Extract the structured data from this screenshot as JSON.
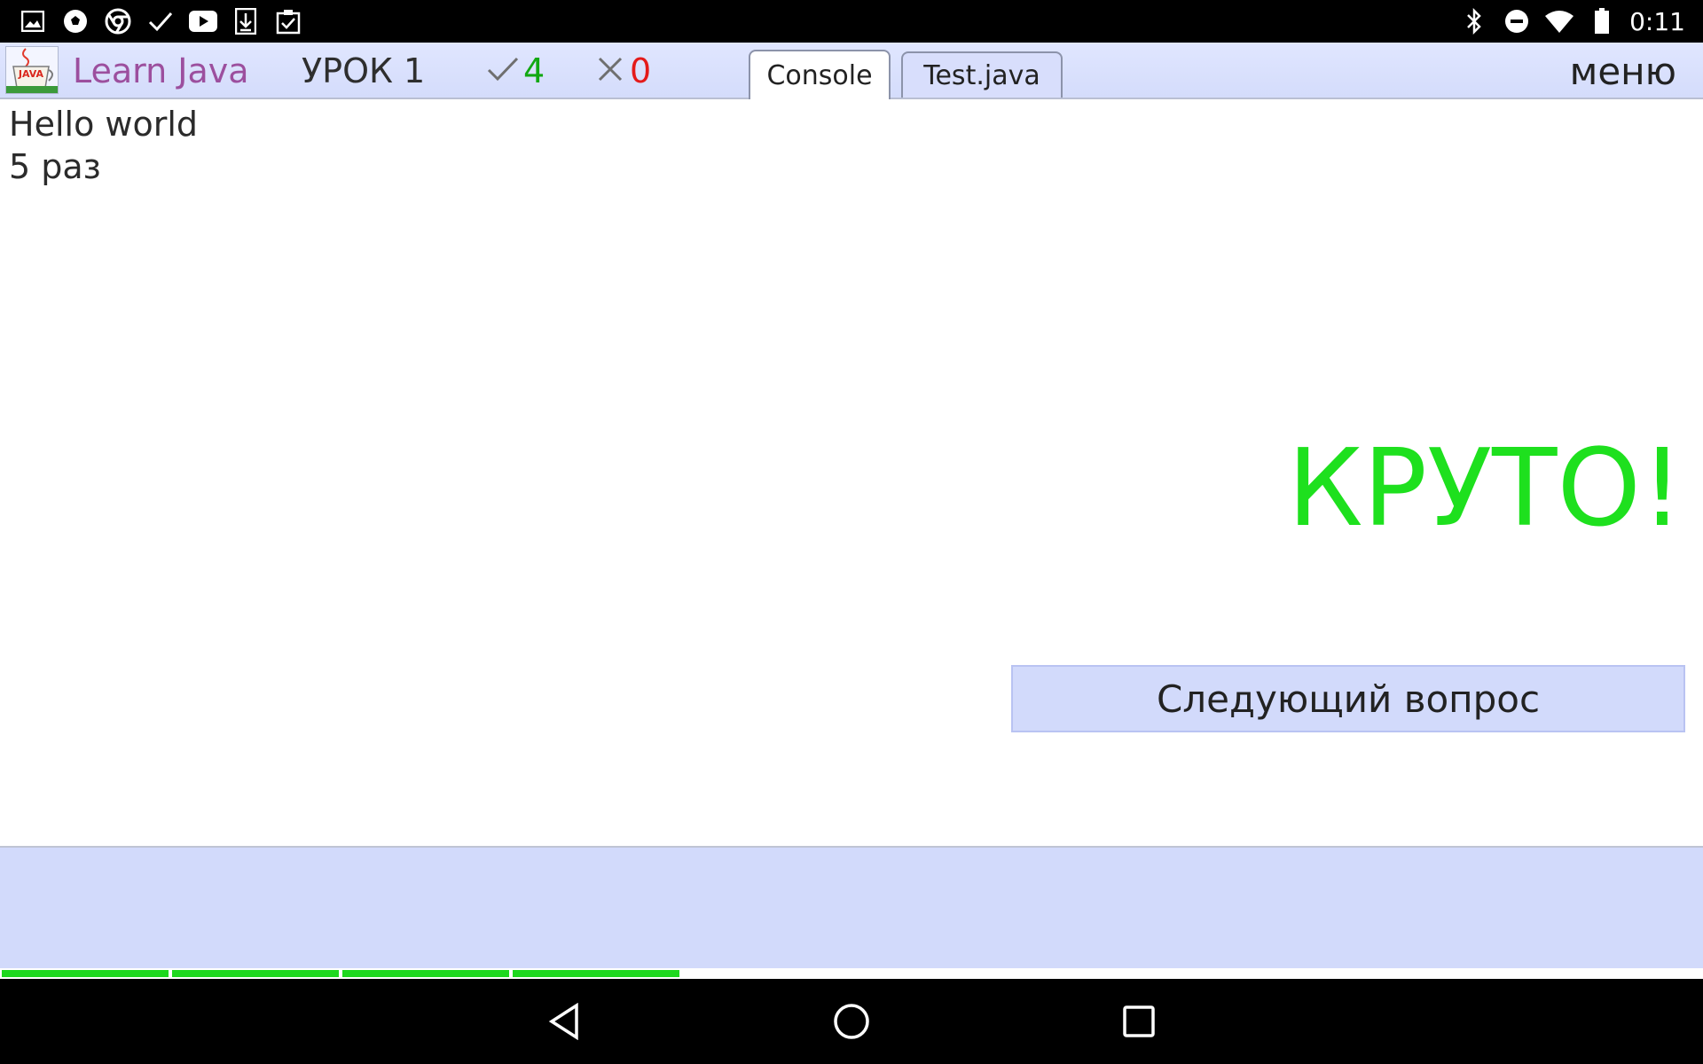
{
  "status_bar": {
    "time": "0:11",
    "left_icons": [
      "image-icon",
      "soccer-ball-icon",
      "chrome-icon",
      "check-icon",
      "youtube-icon",
      "download-icon",
      "clipboard-check-icon"
    ],
    "right_icons": [
      "bluetooth-icon",
      "do-not-disturb-icon",
      "wifi-icon",
      "battery-icon"
    ]
  },
  "app_bar": {
    "app_title": "Learn Java",
    "app_icon_text": "JAVA",
    "lesson": "УРОК 1",
    "correct_count": "4",
    "wrong_count": "0",
    "tabs": [
      {
        "label": "Console",
        "active": true
      },
      {
        "label": "Test.java",
        "active": false
      }
    ],
    "menu_label": "меню"
  },
  "console": {
    "lines": [
      "Hello world",
      "5 раз"
    ],
    "verdict": "КРУТО!",
    "next_button_label": "Следующий вопрос"
  },
  "progress": {
    "completed_segments": 4,
    "accent_color": "#1ed81e"
  },
  "colors": {
    "app_bar_bg": "#d4dcfb",
    "title_color": "#9c4f9e",
    "correct_color": "#12a812",
    "wrong_color": "#e41a1a",
    "verdict_color": "#1ee01e"
  }
}
